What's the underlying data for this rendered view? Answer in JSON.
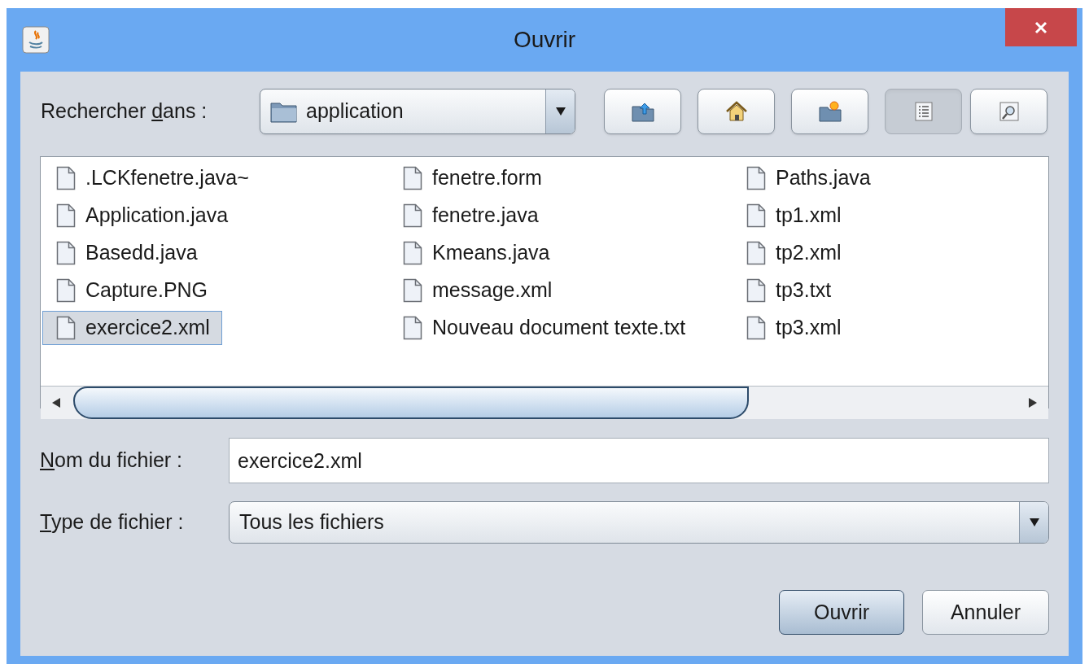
{
  "window": {
    "title": "Ouvrir"
  },
  "look_in": {
    "label": {
      "before": "Rechercher ",
      "key": "d",
      "after": "ans :"
    },
    "value": "application"
  },
  "toolbar": [
    {
      "kind": "up",
      "selected": false
    },
    {
      "kind": "home",
      "selected": false
    },
    {
      "kind": "new-folder",
      "selected": false
    },
    {
      "kind": "list",
      "selected": true
    },
    {
      "kind": "details",
      "selected": false
    }
  ],
  "files": [
    {
      "name": ".LCKfenetre.java~",
      "selected": false
    },
    {
      "name": "Application.java",
      "selected": false
    },
    {
      "name": "Basedd.java",
      "selected": false
    },
    {
      "name": "Capture.PNG",
      "selected": false
    },
    {
      "name": "exercice2.xml",
      "selected": true
    },
    {
      "name": "fenetre.form",
      "selected": false
    },
    {
      "name": "fenetre.java",
      "selected": false
    },
    {
      "name": "Kmeans.java",
      "selected": false
    },
    {
      "name": "message.xml",
      "selected": false
    },
    {
      "name": "Nouveau document texte.txt",
      "selected": false
    },
    {
      "name": "Paths.java",
      "selected": false
    },
    {
      "name": "tp1.xml",
      "selected": false
    },
    {
      "name": "tp2.xml",
      "selected": false
    },
    {
      "name": "tp3.txt",
      "selected": false
    },
    {
      "name": "tp3.xml",
      "selected": false
    }
  ],
  "file_name": {
    "label": {
      "key": "N",
      "after": "om du fichier :"
    },
    "value": "exercice2.xml"
  },
  "file_type": {
    "label": {
      "key": "T",
      "after": "ype de fichier :"
    },
    "value": "Tous les fichiers"
  },
  "buttons": [
    {
      "label": "Ouvrir",
      "default": true
    },
    {
      "label": "Annuler",
      "default": false
    }
  ]
}
